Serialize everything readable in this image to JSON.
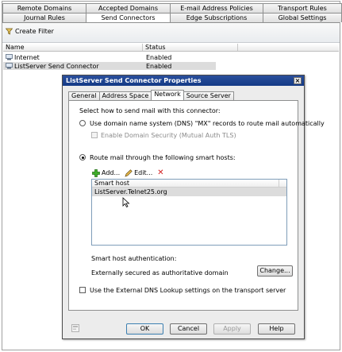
{
  "console": {
    "tabs_row1": [
      "Remote Domains",
      "Accepted Domains",
      "E-mail Address Policies",
      "Transport Rules"
    ],
    "tabs_row2": [
      "Journal Rules",
      "Send Connectors",
      "Edge Subscriptions",
      "Global Settings"
    ],
    "active_tab": "Send Connectors",
    "action_create_filter": "Create Filter",
    "columns": {
      "name": "Name",
      "status": "Status"
    },
    "rows": [
      {
        "name": "Internet",
        "status": "Enabled",
        "selected": false
      },
      {
        "name": "ListServer Send Connector",
        "status": "Enabled",
        "selected": true
      }
    ]
  },
  "dialog": {
    "title": "ListServer Send Connector Properties",
    "close_symbol": "×",
    "tabs": [
      "General",
      "Address Space",
      "Network",
      "Source Server"
    ],
    "active_tab": "Network",
    "select_prompt": "Select how to send mail with this connector:",
    "option_dns": "Use domain name system (DNS) \"MX\" records to route mail automatically",
    "option_dns_checkbox": "Enable Domain Security (Mutual Auth TLS)",
    "option_smarthost": "Route mail through the following smart hosts:",
    "toolbar": {
      "add": "Add...",
      "edit": "Edit...",
      "remove_symbol": "✕"
    },
    "smarthost_column": "Smart host",
    "smarthosts": [
      "ListServer.Telnet25.org"
    ],
    "auth_label": "Smart host authentication:",
    "auth_value": "Externally secured as authoritative domain",
    "change_button": "Change...",
    "external_dns_checkbox": "Use the External DNS Lookup settings on the transport server",
    "buttons": {
      "ok": "OK",
      "cancel": "Cancel",
      "apply": "Apply",
      "help": "Help"
    }
  }
}
